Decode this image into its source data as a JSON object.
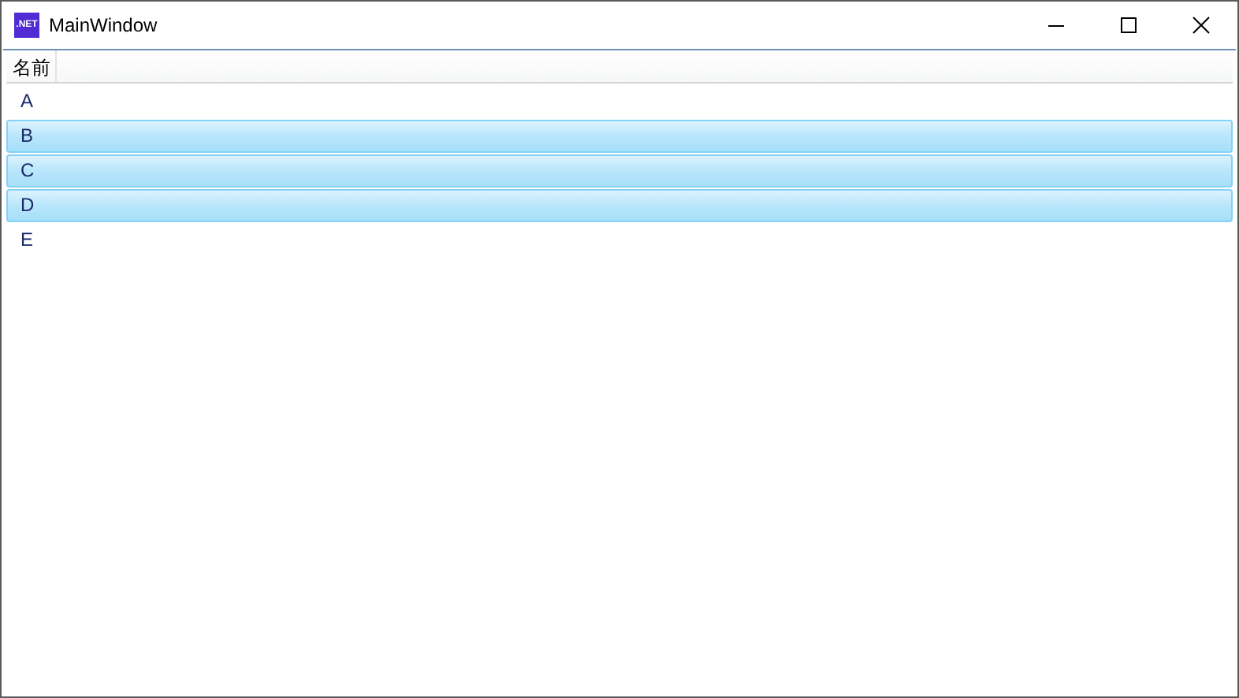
{
  "window": {
    "title": "MainWindow",
    "icon_label": ".NET"
  },
  "list": {
    "columns": [
      "名前"
    ],
    "rows": [
      {
        "name": "A",
        "selected": false
      },
      {
        "name": "B",
        "selected": true
      },
      {
        "name": "C",
        "selected": true
      },
      {
        "name": "D",
        "selected": true
      },
      {
        "name": "E",
        "selected": false
      }
    ]
  }
}
